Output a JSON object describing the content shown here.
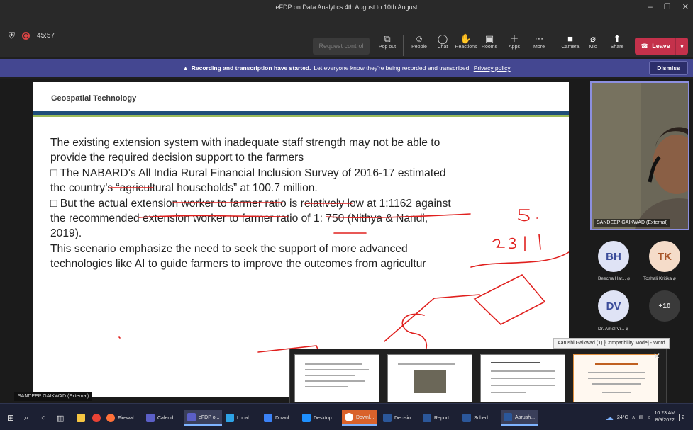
{
  "window": {
    "title": "eFDP on Data Analytics 4th August to 10th August",
    "min": "–",
    "max": "❐",
    "close": "✕"
  },
  "toolbar": {
    "timer": "45:57",
    "request_control": "Request control",
    "items": [
      "Pop out",
      "People",
      "Chat",
      "Reactions",
      "Rooms",
      "Apps",
      "More",
      "Camera",
      "Mic",
      "Share"
    ],
    "leave": "Leave"
  },
  "banner": {
    "bold": "Recording and transcription have started.",
    "text": "Let everyone know they're being recorded and transcribed.",
    "link": "Privacy policy",
    "dismiss": "Dismiss"
  },
  "slide": {
    "title": "Geospatial Technology",
    "lines": [
      "The existing extension system with inadequate staff strength may not be able to",
      "provide the required decision support to the farmers",
      "□ The NABARD’s All India Rural Financial Inclusion Survey of 2016-17 estimated",
      "the country’s “agricultural households” at 100.7 million.",
      "□ But the actual extension worker to farmer ratio is relatively low at 1:1162 against",
      "the recommended extension worker to farmer ratio of 1: 750 (Nithya & Nandi,",
      "2019).",
      "This scenario emphasize the need to seek the support of more advanced",
      "technologies like AI to guide farmers to improve the outcomes from agricultur"
    ]
  },
  "presenter_caption": "SANDEEP GAIKWAD (External)",
  "participants": {
    "self_name": "SANDEEP GAIKWAD (External)",
    "list": [
      {
        "initials": "BH",
        "name": "Beecha Har...",
        "bg": "#dfe3f5",
        "fg": "#3b4c9a"
      },
      {
        "initials": "TK",
        "name": "Toshali Kritika",
        "bg": "#f5dcc9",
        "fg": "#a8562a"
      },
      {
        "initials": "DV",
        "name": "Dr. Amol Vi...",
        "bg": "#dfe3f5",
        "fg": "#3b4c9a"
      }
    ],
    "more": "+10"
  },
  "tooltip": "Aarushi Gaikwad (1) [Compatibility Mode] - Word",
  "taskbar": {
    "apps": [
      "Firewal...",
      "Calend...",
      "eFDP o...",
      "Local ...",
      "Downl...",
      "Desktop",
      "Downl...",
      "Decisio...",
      "Report...",
      "Sched...",
      "Aarush..."
    ],
    "weather": "24°C",
    "time": "10:23 AM",
    "date": "8/9/2022",
    "notif": "2"
  },
  "colors": {
    "accent": "#444791",
    "leave": "#c4314b",
    "slide_bar": "#1f4e79",
    "ink": "#e0201e"
  }
}
